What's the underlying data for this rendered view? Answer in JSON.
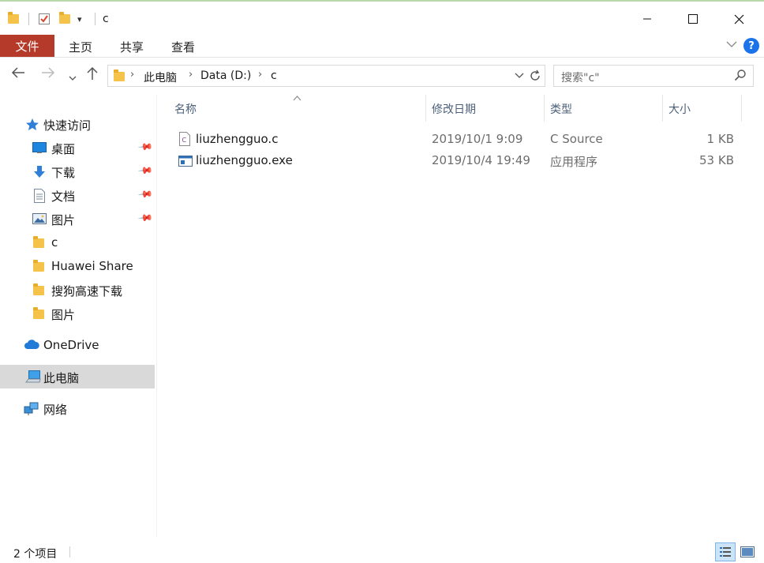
{
  "window": {
    "title": "c",
    "controls": {
      "minimize": "—",
      "maximize": "☐",
      "close": "✕"
    }
  },
  "ribbon": {
    "tabs": [
      "文件",
      "主页",
      "共享",
      "查看"
    ],
    "help": "?"
  },
  "address": {
    "crumbs": [
      "此电脑",
      "Data (D:)",
      "c"
    ],
    "search_placeholder": "搜索\"c\""
  },
  "nav": {
    "quick_access": "快速访问",
    "items": [
      {
        "label": "桌面",
        "pinned": true
      },
      {
        "label": "下载",
        "pinned": true
      },
      {
        "label": "文档",
        "pinned": true
      },
      {
        "label": "图片",
        "pinned": true
      },
      {
        "label": "c",
        "pinned": false
      },
      {
        "label": "Huawei Share",
        "pinned": false
      },
      {
        "label": "搜狗高速下载",
        "pinned": false
      },
      {
        "label": "图片",
        "pinned": false
      }
    ],
    "onedrive": "OneDrive",
    "this_pc": "此电脑",
    "network": "网络"
  },
  "columns": [
    "名称",
    "修改日期",
    "类型",
    "大小"
  ],
  "files": [
    {
      "name": "liuzhengguo.c",
      "modified": "2019/10/1 9:09",
      "type": "C Source",
      "size": "1 KB",
      "icon": "c-source-file-icon"
    },
    {
      "name": "liuzhengguo.exe",
      "modified": "2019/10/4 19:49",
      "type": "应用程序",
      "size": "53 KB",
      "icon": "application-file-icon"
    }
  ],
  "status": {
    "item_count": "2 个项目"
  },
  "colors": {
    "file_tab": "#b63a2a",
    "help": "#1a73e8",
    "folder": "#f6c34a",
    "selected": "#d9d9d9"
  }
}
